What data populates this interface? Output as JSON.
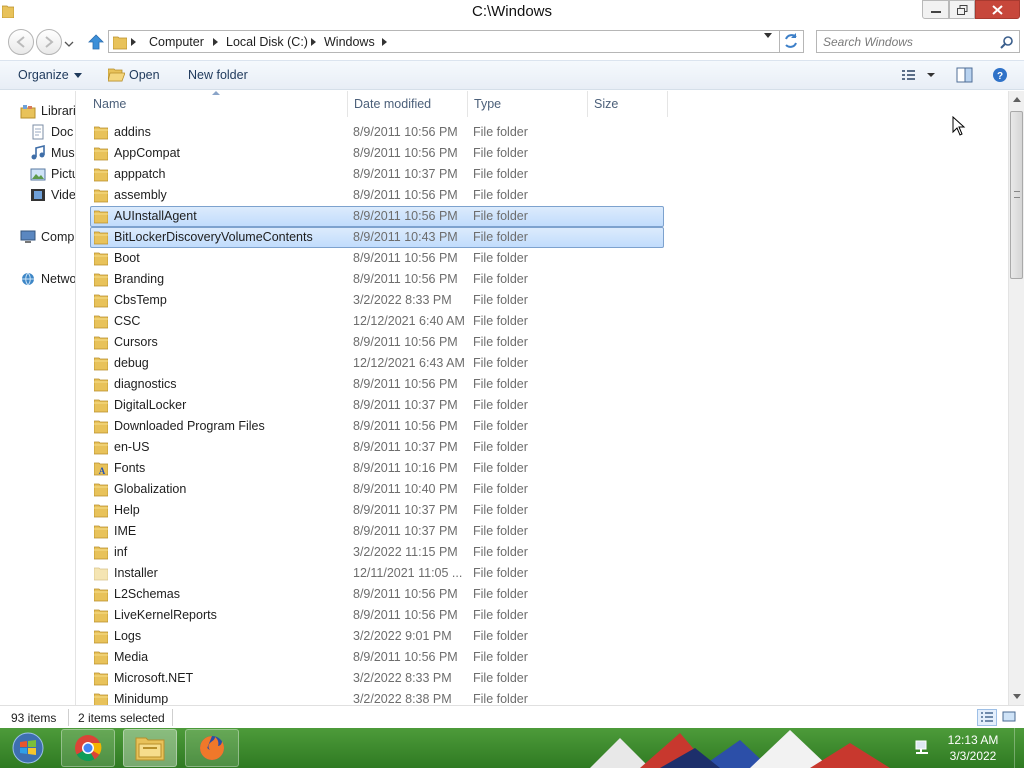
{
  "window": {
    "title": "C:\\Windows"
  },
  "address_bar": {
    "breadcrumbs": [
      "Computer",
      "Local Disk (C:)",
      "Windows"
    ],
    "search_placeholder": "Search Windows"
  },
  "command_bar": {
    "organize": "Organize",
    "open": "Open",
    "new_folder": "New folder"
  },
  "nav_pane": {
    "items": [
      {
        "label": "Librari",
        "icon": "libraries-icon"
      },
      {
        "label": "Doc",
        "icon": "documents-icon"
      },
      {
        "label": "Mus",
        "icon": "music-icon"
      },
      {
        "label": "Pictu",
        "icon": "pictures-icon"
      },
      {
        "label": "Vide",
        "icon": "videos-icon"
      },
      {
        "label": "Comp",
        "icon": "computer-icon"
      },
      {
        "label": "Netwo",
        "icon": "network-icon"
      }
    ]
  },
  "columns": {
    "name": "Name",
    "date": "Date modified",
    "type": "Type",
    "size": "Size"
  },
  "files": [
    {
      "name": "addins",
      "date": "8/9/2011 10:56 PM",
      "type": "File folder",
      "selected": false
    },
    {
      "name": "AppCompat",
      "date": "8/9/2011 10:56 PM",
      "type": "File folder",
      "selected": false
    },
    {
      "name": "apppatch",
      "date": "8/9/2011 10:37 PM",
      "type": "File folder",
      "selected": false
    },
    {
      "name": "assembly",
      "date": "8/9/2011 10:56 PM",
      "type": "File folder",
      "selected": false
    },
    {
      "name": "AUInstallAgent",
      "date": "8/9/2011 10:56 PM",
      "type": "File folder",
      "selected": true
    },
    {
      "name": "BitLockerDiscoveryVolumeContents",
      "date": "8/9/2011 10:43 PM",
      "type": "File folder",
      "selected": true
    },
    {
      "name": "Boot",
      "date": "8/9/2011 10:56 PM",
      "type": "File folder",
      "selected": false
    },
    {
      "name": "Branding",
      "date": "8/9/2011 10:56 PM",
      "type": "File folder",
      "selected": false
    },
    {
      "name": "CbsTemp",
      "date": "3/2/2022 8:33 PM",
      "type": "File folder",
      "selected": false
    },
    {
      "name": "CSC",
      "date": "12/12/2021 6:40 AM",
      "type": "File folder",
      "selected": false
    },
    {
      "name": "Cursors",
      "date": "8/9/2011 10:56 PM",
      "type": "File folder",
      "selected": false
    },
    {
      "name": "debug",
      "date": "12/12/2021 6:43 AM",
      "type": "File folder",
      "selected": false
    },
    {
      "name": "diagnostics",
      "date": "8/9/2011 10:56 PM",
      "type": "File folder",
      "selected": false
    },
    {
      "name": "DigitalLocker",
      "date": "8/9/2011 10:37 PM",
      "type": "File folder",
      "selected": false
    },
    {
      "name": "Downloaded Program Files",
      "date": "8/9/2011 10:56 PM",
      "type": "File folder",
      "selected": false
    },
    {
      "name": "en-US",
      "date": "8/9/2011 10:37 PM",
      "type": "File folder",
      "selected": false
    },
    {
      "name": "Fonts",
      "date": "8/9/2011 10:16 PM",
      "type": "File folder",
      "selected": false,
      "icon": "fonts-folder-icon"
    },
    {
      "name": "Globalization",
      "date": "8/9/2011 10:40 PM",
      "type": "File folder",
      "selected": false
    },
    {
      "name": "Help",
      "date": "8/9/2011 10:37 PM",
      "type": "File folder",
      "selected": false
    },
    {
      "name": "IME",
      "date": "8/9/2011 10:37 PM",
      "type": "File folder",
      "selected": false
    },
    {
      "name": "inf",
      "date": "3/2/2022 11:15 PM",
      "type": "File folder",
      "selected": false
    },
    {
      "name": "Installer",
      "date": "12/11/2021 11:05 ...",
      "type": "File folder",
      "selected": false,
      "icon": "hidden-folder-icon"
    },
    {
      "name": "L2Schemas",
      "date": "8/9/2011 10:56 PM",
      "type": "File folder",
      "selected": false
    },
    {
      "name": "LiveKernelReports",
      "date": "8/9/2011 10:56 PM",
      "type": "File folder",
      "selected": false
    },
    {
      "name": "Logs",
      "date": "3/2/2022 9:01 PM",
      "type": "File folder",
      "selected": false
    },
    {
      "name": "Media",
      "date": "8/9/2011 10:56 PM",
      "type": "File folder",
      "selected": false
    },
    {
      "name": "Microsoft.NET",
      "date": "3/2/2022 8:33 PM",
      "type": "File folder",
      "selected": false
    },
    {
      "name": "Minidump",
      "date": "3/2/2022 8:38 PM",
      "type": "File folder",
      "selected": false
    }
  ],
  "status": {
    "item_count": "93 items",
    "selection": "2 items selected"
  },
  "taskbar": {
    "apps": [
      "chrome-icon",
      "file-explorer-icon",
      "firefox-icon"
    ],
    "clock_time": "12:13 AM",
    "clock_date": "3/3/2022"
  },
  "colors": {
    "folder": "#e8c25a",
    "selection": "#cce2fc",
    "selection_border": "#7da2ce",
    "taskbar": "#3f8a2f",
    "close_button": "#c7473b"
  }
}
